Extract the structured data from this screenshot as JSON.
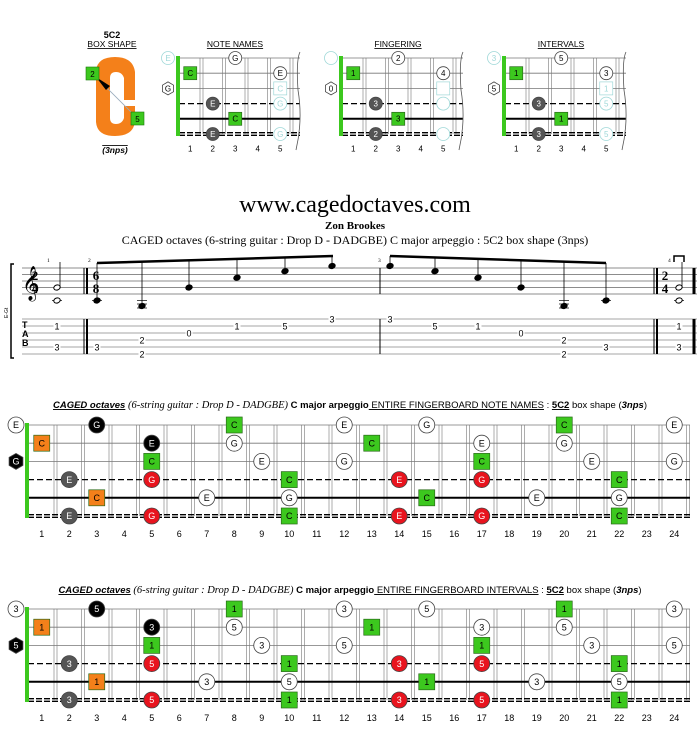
{
  "colors": {
    "green": "#3cc81e",
    "orange": "#f4801a",
    "red": "#e8141e",
    "gray": "#555555",
    "black": "#000000",
    "faded": "#9fd8d8"
  },
  "shape": {
    "code": "5C2",
    "label": "BOX SHAPE",
    "nps": "(3nps)",
    "markers": [
      "2",
      "5"
    ]
  },
  "mini_fret_labels": [
    "1",
    "2",
    "3",
    "4",
    "5"
  ],
  "mini_diagrams": [
    {
      "title": "NOTE NAMES",
      "notes": [
        [
          1,
          0,
          "E",
          "faded"
        ],
        [
          1,
          3,
          "G",
          "white"
        ],
        [
          2,
          1,
          "C",
          "green"
        ],
        [
          2,
          5,
          "E",
          "white"
        ],
        [
          3,
          0,
          "G",
          "whitehex"
        ],
        [
          3,
          5,
          "C",
          "fadedsq"
        ],
        [
          4,
          2,
          "E",
          "gray"
        ],
        [
          4,
          5,
          "G",
          "faded"
        ],
        [
          5,
          3,
          "C",
          "green"
        ],
        [
          6,
          2,
          "E",
          "gray"
        ],
        [
          6,
          5,
          "G",
          "faded"
        ]
      ]
    },
    {
      "title": "FINGERING",
      "notes": [
        [
          1,
          0,
          "",
          "faded"
        ],
        [
          1,
          3,
          "2",
          "white"
        ],
        [
          2,
          1,
          "1",
          "green"
        ],
        [
          2,
          5,
          "4",
          "white"
        ],
        [
          3,
          0,
          "0",
          "whitehex"
        ],
        [
          3,
          5,
          "",
          "fadedsq"
        ],
        [
          4,
          2,
          "3",
          "gray"
        ],
        [
          4,
          5,
          "",
          "faded"
        ],
        [
          5,
          3,
          "3",
          "green"
        ],
        [
          6,
          2,
          "2",
          "gray"
        ],
        [
          6,
          5,
          "",
          "faded"
        ]
      ]
    },
    {
      "title": "INTERVALS",
      "notes": [
        [
          1,
          0,
          "3",
          "faded"
        ],
        [
          1,
          3,
          "5",
          "white"
        ],
        [
          2,
          1,
          "1",
          "green"
        ],
        [
          2,
          5,
          "3",
          "white"
        ],
        [
          3,
          0,
          "5",
          "whitehex"
        ],
        [
          3,
          5,
          "1",
          "fadedsq"
        ],
        [
          4,
          2,
          "3",
          "gray"
        ],
        [
          4,
          5,
          "5",
          "faded"
        ],
        [
          5,
          3,
          "1",
          "green"
        ],
        [
          6,
          2,
          "3",
          "gray"
        ],
        [
          6,
          5,
          "5",
          "faded"
        ]
      ]
    }
  ],
  "header": {
    "site": "www.cagedoctaves.com",
    "author": "Zon Brookes",
    "subtitle": "CAGED octaves (6-string guitar : Drop D - DADGBE) C major arpeggio : 5C2 box shape (3nps)"
  },
  "notation": {
    "instrument": "E-Gt",
    "tab_letters": [
      "T",
      "A",
      "B"
    ],
    "time_signatures": [
      [
        "2",
        "4"
      ],
      [
        "6",
        "8"
      ],
      [
        "2",
        "4"
      ]
    ],
    "measure_numbers": [
      "1",
      "2",
      "3",
      "4"
    ],
    "measures": [
      {
        "pitches": [
          [
            "C4",
            "G4"
          ]
        ],
        "tab": [
          [
            [
              2,
              "1"
            ],
            [
              5,
              "3"
            ]
          ]
        ]
      },
      {
        "pitches": [
          [
            "C4"
          ],
          [
            "D3"
          ],
          [
            "G4"
          ],
          [
            "C5"
          ],
          [
            "E5"
          ],
          [
            "G5"
          ]
        ],
        "tab": [
          [
            [
              5,
              "3"
            ]
          ],
          [
            [
              4,
              "2"
            ],
            [
              6,
              "2"
            ]
          ],
          [
            [
              3,
              "0"
            ]
          ],
          [
            [
              2,
              "1"
            ]
          ],
          [
            [
              2,
              "5"
            ]
          ],
          [
            [
              1,
              "3"
            ]
          ]
        ]
      },
      {
        "pitches": [
          [
            "G5"
          ],
          [
            "E5"
          ],
          [
            "C5"
          ],
          [
            "G4"
          ],
          [
            "D3"
          ],
          [
            "C4"
          ]
        ],
        "tab": [
          [
            [
              1,
              "3"
            ]
          ],
          [
            [
              2,
              "5"
            ]
          ],
          [
            [
              2,
              "1"
            ]
          ],
          [
            [
              3,
              "0"
            ]
          ],
          [
            [
              4,
              "2"
            ],
            [
              6,
              "2"
            ]
          ],
          [
            [
              5,
              "3"
            ]
          ]
        ]
      },
      {
        "pitches": [
          [
            "C4",
            "G4"
          ]
        ],
        "tab": [
          [
            [
              2,
              "1"
            ],
            [
              5,
              "3"
            ]
          ]
        ]
      }
    ]
  },
  "fret_labels": [
    "1",
    "2",
    "3",
    "4",
    "5",
    "6",
    "7",
    "8",
    "9",
    "10",
    "11",
    "12",
    "13",
    "14",
    "15",
    "16",
    "17",
    "18",
    "19",
    "20",
    "21",
    "22",
    "23",
    "24"
  ],
  "boards": [
    {
      "title": [
        [
          "CAGED octaves",
          "bi-u"
        ],
        [
          " (6-string guitar : ",
          "serif"
        ],
        [
          "Drop D",
          "serif-i"
        ],
        [
          " - DADGBE) ",
          "serif"
        ],
        [
          "C major arpeggio",
          "b"
        ],
        [
          " ENTIRE FINGERBOARD NOTE NAMES",
          "u"
        ],
        [
          " : ",
          ""
        ],
        [
          "5C2",
          "b-u"
        ],
        [
          " box shape (",
          ""
        ],
        [
          "3nps",
          "bi"
        ],
        [
          ")",
          ""
        ]
      ],
      "notes": [
        [
          1,
          0,
          "E",
          "white"
        ],
        [
          1,
          3,
          "G",
          "black"
        ],
        [
          1,
          8,
          "C",
          "green"
        ],
        [
          1,
          12,
          "E",
          "white"
        ],
        [
          1,
          15,
          "G",
          "white"
        ],
        [
          1,
          20,
          "C",
          "green"
        ],
        [
          1,
          24,
          "E",
          "white"
        ],
        [
          2,
          1,
          "C",
          "orange"
        ],
        [
          2,
          5,
          "E",
          "black"
        ],
        [
          2,
          8,
          "G",
          "white"
        ],
        [
          2,
          13,
          "C",
          "green"
        ],
        [
          2,
          17,
          "E",
          "white"
        ],
        [
          2,
          20,
          "G",
          "white"
        ],
        [
          3,
          0,
          "G",
          "blackhex"
        ],
        [
          3,
          5,
          "C",
          "green"
        ],
        [
          3,
          9,
          "E",
          "white"
        ],
        [
          3,
          12,
          "G",
          "white"
        ],
        [
          3,
          17,
          "C",
          "green"
        ],
        [
          3,
          21,
          "E",
          "white"
        ],
        [
          3,
          24,
          "G",
          "white"
        ],
        [
          4,
          2,
          "E",
          "gray"
        ],
        [
          4,
          5,
          "G",
          "red"
        ],
        [
          4,
          10,
          "C",
          "green"
        ],
        [
          4,
          14,
          "E",
          "red"
        ],
        [
          4,
          17,
          "G",
          "red"
        ],
        [
          4,
          22,
          "C",
          "green"
        ],
        [
          5,
          3,
          "C",
          "orange"
        ],
        [
          5,
          7,
          "E",
          "white"
        ],
        [
          5,
          10,
          "G",
          "white"
        ],
        [
          5,
          15,
          "C",
          "green"
        ],
        [
          5,
          19,
          "E",
          "white"
        ],
        [
          5,
          22,
          "G",
          "white"
        ],
        [
          6,
          2,
          "E",
          "gray"
        ],
        [
          6,
          5,
          "G",
          "red"
        ],
        [
          6,
          10,
          "C",
          "green"
        ],
        [
          6,
          14,
          "E",
          "red"
        ],
        [
          6,
          17,
          "G",
          "red"
        ],
        [
          6,
          22,
          "C",
          "green"
        ]
      ]
    },
    {
      "title": [
        [
          "CAGED octaves",
          "bi-u"
        ],
        [
          " (6-string guitar : ",
          "serif"
        ],
        [
          "Drop D",
          "serif-i"
        ],
        [
          " - DADGBE) ",
          "serif"
        ],
        [
          "C major arpeggio",
          "b"
        ],
        [
          " ENTIRE FINGERBOARD INTERVALS",
          "u"
        ],
        [
          " : ",
          ""
        ],
        [
          "5C2",
          "b-u"
        ],
        [
          " box shape (",
          ""
        ],
        [
          "3nps",
          "bi"
        ],
        [
          ")",
          ""
        ]
      ],
      "notes": [
        [
          1,
          0,
          "3",
          "white"
        ],
        [
          1,
          3,
          "5",
          "black"
        ],
        [
          1,
          8,
          "1",
          "green"
        ],
        [
          1,
          12,
          "3",
          "white"
        ],
        [
          1,
          15,
          "5",
          "white"
        ],
        [
          1,
          20,
          "1",
          "green"
        ],
        [
          1,
          24,
          "3",
          "white"
        ],
        [
          2,
          1,
          "1",
          "orange"
        ],
        [
          2,
          5,
          "3",
          "black"
        ],
        [
          2,
          8,
          "5",
          "white"
        ],
        [
          2,
          13,
          "1",
          "green"
        ],
        [
          2,
          17,
          "3",
          "white"
        ],
        [
          2,
          20,
          "5",
          "white"
        ],
        [
          3,
          0,
          "5",
          "blackhex"
        ],
        [
          3,
          5,
          "1",
          "green"
        ],
        [
          3,
          9,
          "3",
          "white"
        ],
        [
          3,
          12,
          "5",
          "white"
        ],
        [
          3,
          17,
          "1",
          "green"
        ],
        [
          3,
          21,
          "3",
          "white"
        ],
        [
          3,
          24,
          "5",
          "white"
        ],
        [
          4,
          2,
          "3",
          "gray"
        ],
        [
          4,
          5,
          "5",
          "red"
        ],
        [
          4,
          10,
          "1",
          "green"
        ],
        [
          4,
          14,
          "3",
          "red"
        ],
        [
          4,
          17,
          "5",
          "red"
        ],
        [
          4,
          22,
          "1",
          "green"
        ],
        [
          5,
          3,
          "1",
          "orange"
        ],
        [
          5,
          7,
          "3",
          "white"
        ],
        [
          5,
          10,
          "5",
          "white"
        ],
        [
          5,
          15,
          "1",
          "green"
        ],
        [
          5,
          19,
          "3",
          "white"
        ],
        [
          5,
          22,
          "5",
          "white"
        ],
        [
          6,
          2,
          "3",
          "gray"
        ],
        [
          6,
          5,
          "5",
          "red"
        ],
        [
          6,
          10,
          "1",
          "green"
        ],
        [
          6,
          14,
          "3",
          "red"
        ],
        [
          6,
          17,
          "5",
          "red"
        ],
        [
          6,
          22,
          "1",
          "green"
        ]
      ]
    }
  ]
}
